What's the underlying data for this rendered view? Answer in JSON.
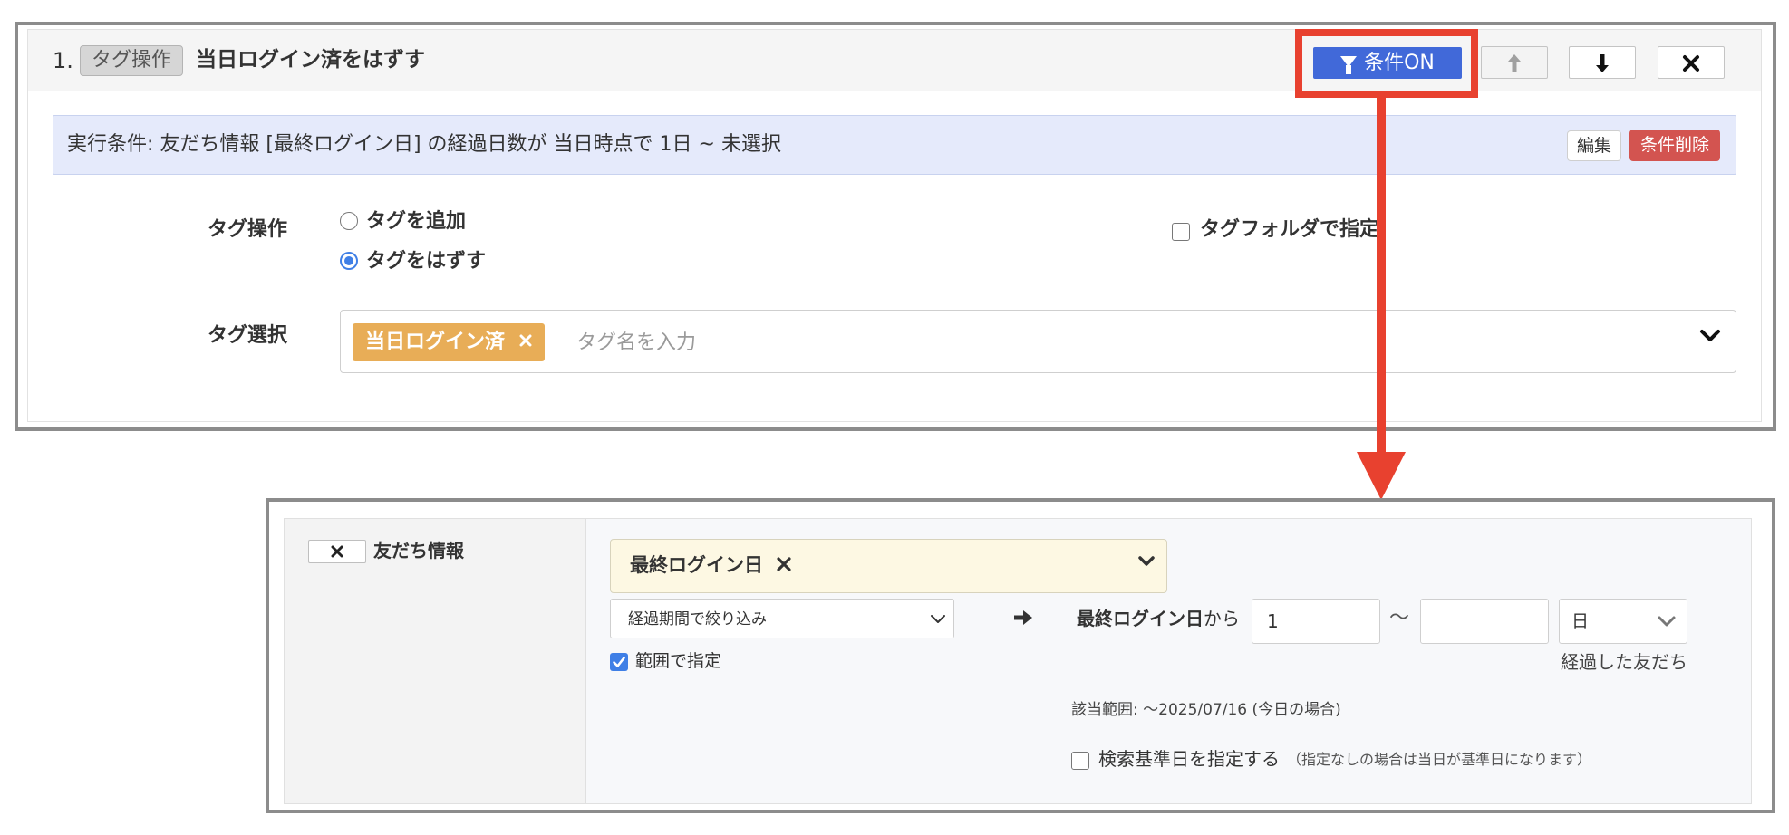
{
  "step": {
    "number": "1.",
    "badge": "タグ操作",
    "title": "当日ログイン済をはずす",
    "condition_button": "条件ON",
    "move_up_icon": "arrow-up-icon",
    "move_down_icon": "arrow-down-icon",
    "delete_icon": "close-icon"
  },
  "condition_bar": {
    "text": "実行条件: 友だち情報 [最終ログイン日] の経過日数が 当日時点で 1日 ~ 未選択",
    "edit_label": "編集",
    "remove_label": "条件削除"
  },
  "tag_operation": {
    "label": "タグ操作",
    "options": [
      "タグを追加",
      "タグをはずす"
    ],
    "selected": "タグをはずす",
    "folder_checkbox_label": "タグフォルダで指定",
    "folder_checked": false
  },
  "tag_select": {
    "label": "タグ選択",
    "chip": "当日ログイン済",
    "placeholder": "タグ名を入力"
  },
  "filter": {
    "remove_icon": "close-icon",
    "source_label": "友だち情報",
    "field": "最終ログイン日",
    "mode": "経過期間で絞り込み",
    "range_checkbox_label": "範囲で指定",
    "range_checked": true,
    "since_field": "最終ログイン日",
    "since_suffix": "から",
    "from_value": "1",
    "tilde": "〜",
    "to_value": "",
    "unit": "日",
    "elapsed_text": "経過した友だち",
    "applicable_range": "該当範囲: ～2025/07/16 (今日の場合)",
    "base_date_label": "検索基準日を指定する",
    "base_date_note": "（指定なしの場合は当日が基準日になります）",
    "base_date_checked": false
  },
  "colors": {
    "condition_on": "#4169d9",
    "highlight": "#e8412f",
    "danger": "#d35450",
    "tag_chip": "#e8ad57",
    "condition_bar_bg": "#e5eafb",
    "field_bg": "#fdf8e3"
  }
}
